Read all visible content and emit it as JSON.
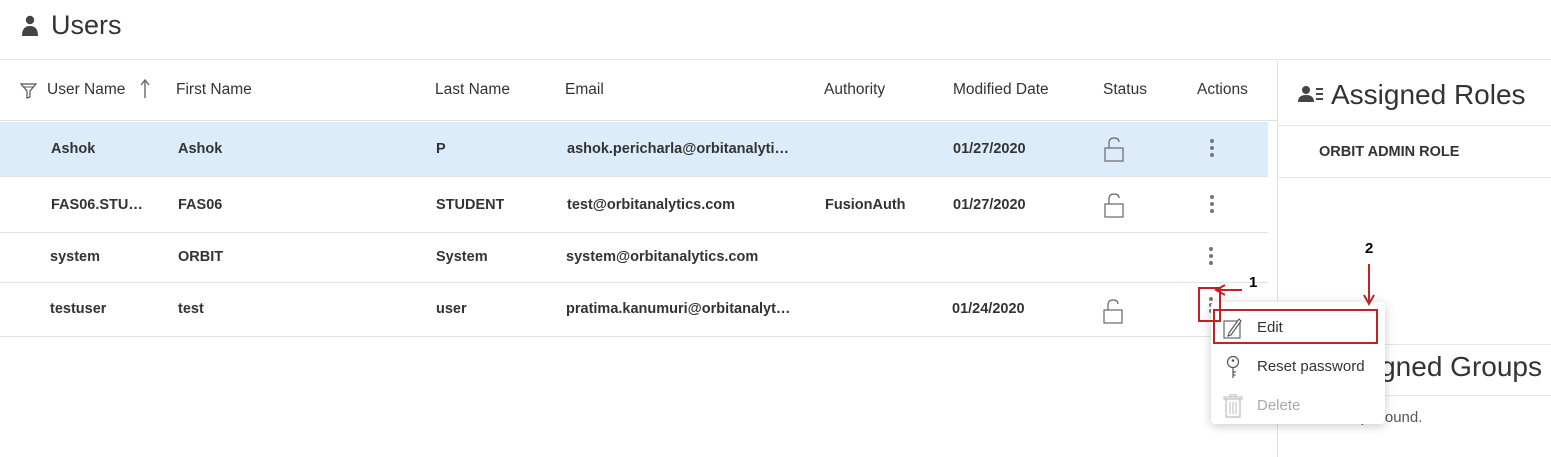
{
  "page": {
    "title": "Users"
  },
  "table": {
    "columns": [
      "User Name",
      "First Name",
      "Last Name",
      "Email",
      "Authority",
      "Modified Date",
      "Status",
      "Actions"
    ],
    "rows": [
      {
        "username": "Ashok",
        "first": "Ashok",
        "last": "P",
        "email": "ashok.pericharla@orbitanalyti…",
        "authority": "",
        "modified": "01/27/2020",
        "locked_icon": true
      },
      {
        "username": "FAS06.STU…",
        "first": "FAS06",
        "last": "STUDENT",
        "email": "test@orbitanalytics.com",
        "authority": "FusionAuth",
        "modified": "01/27/2020",
        "locked_icon": true
      },
      {
        "username": "system",
        "first": "ORBIT",
        "last": "System",
        "email": "system@orbitanalytics.com",
        "authority": "",
        "modified": "",
        "locked_icon": false
      },
      {
        "username": "testuser",
        "first": "test",
        "last": "user",
        "email": "pratima.kanumuri@orbitanalyt…",
        "authority": "",
        "modified": "01/24/2020",
        "locked_icon": true
      }
    ]
  },
  "assigned_roles": {
    "title": "Assigned Roles",
    "items": [
      "ORBIT ADMIN ROLE"
    ]
  },
  "assigned_groups": {
    "title": "Assigned Groups",
    "empty_text": "No Groups found."
  },
  "actions_menu": {
    "items": [
      {
        "label": "Edit",
        "icon": "pencil-icon",
        "enabled": true
      },
      {
        "label": "Reset password",
        "icon": "key-icon",
        "enabled": true
      },
      {
        "label": "Delete",
        "icon": "trash-icon",
        "enabled": false
      }
    ]
  },
  "annotations": {
    "label_1": "1",
    "label_2": "2",
    "color": "#c0222a"
  },
  "colors": {
    "selected_row": "#dcecfb"
  }
}
